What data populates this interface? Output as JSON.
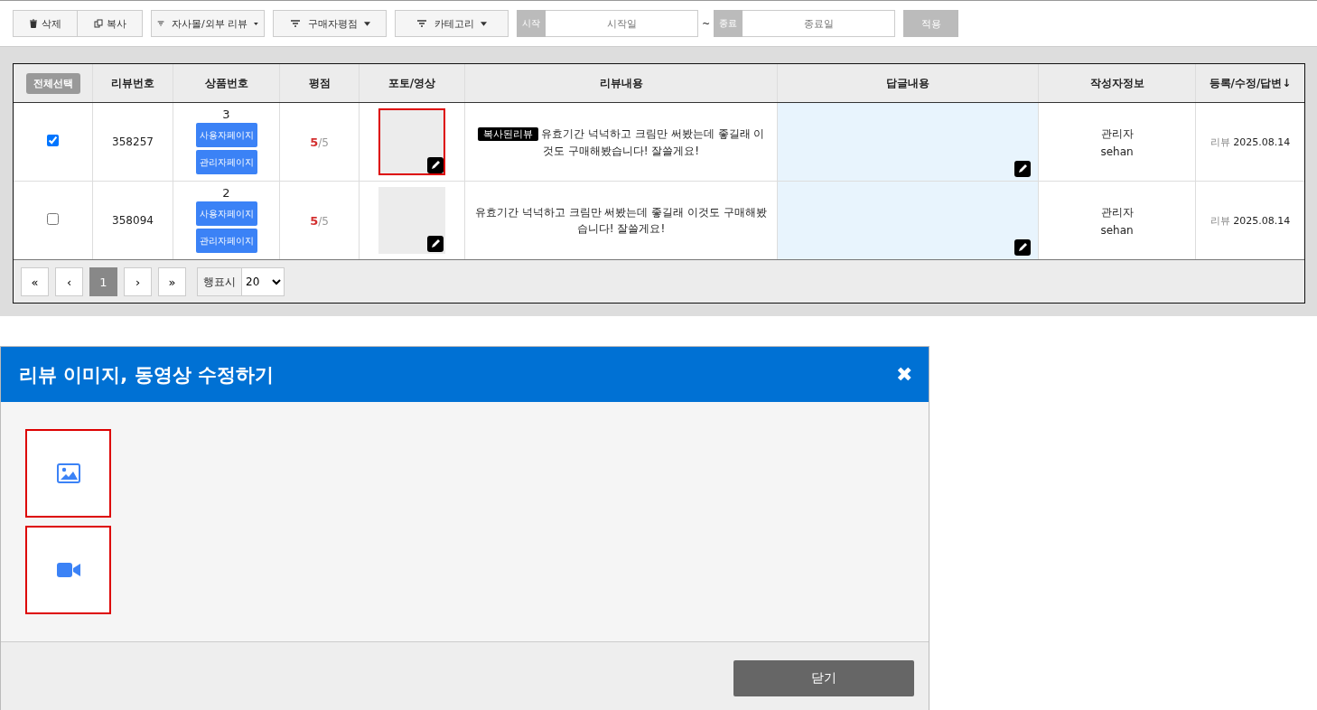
{
  "toolbar": {
    "groups": [
      [
        {
          "kind": "trash",
          "label": "삭제"
        },
        {
          "kind": "copy",
          "label": "복사"
        }
      ],
      [
        {
          "kind": "filter",
          "label": "자사몰/외부 리뷰"
        }
      ],
      [
        {
          "kind": "filter",
          "label": "구매자평점"
        }
      ],
      [
        {
          "kind": "filter",
          "label": "카테고리"
        }
      ]
    ],
    "start": {
      "tag": "시작",
      "placeholder": "시작일"
    },
    "separator": "~",
    "end": {
      "tag": "종료",
      "placeholder": "종료일"
    },
    "apply": "적용"
  },
  "table": {
    "select_all": "전체선택",
    "columns": [
      "리뷰번호",
      "상품번호",
      "평점",
      "포토/영상",
      "리뷰내용",
      "답글내용",
      "작성자정보",
      "등록/수정/답변↓"
    ],
    "rows": [
      {
        "selected": true,
        "review_no": "358257",
        "product_no": "3",
        "user_page": "사용자페이지",
        "admin_page": "관리자페이지",
        "score": "5",
        "max": "/5",
        "photo_highlighted": true,
        "badge": "복사된리뷰",
        "content": "유효기간 넉넉하고 크림만 써봤는데 좋길래 이것도 구매해봤습니다! 잘쓸게요!",
        "author_role": "관리자",
        "author_id": "sehan",
        "date_label": "리뷰",
        "date": "2025.08.14"
      },
      {
        "selected": false,
        "review_no": "358094",
        "product_no": "2",
        "user_page": "사용자페이지",
        "admin_page": "관리자페이지",
        "score": "5",
        "max": "/5",
        "photo_highlighted": false,
        "content": "유효기간 넉넉하고 크림만 써봤는데 좋길래 이것도 구매해봤습니다! 잘쓸게요!",
        "author_role": "관리자",
        "author_id": "sehan",
        "date_label": "리뷰",
        "date": "2025.08.14"
      }
    ]
  },
  "pagination": {
    "first": "«",
    "prev": "‹",
    "pages": [
      {
        "label": "1",
        "selected": true
      }
    ],
    "next": "›",
    "last": "»",
    "rows_label": "행표시",
    "rows_value": "20"
  },
  "modal": {
    "title": "리뷰 이미지, 동영상 수정하기",
    "close_icon": "✖",
    "slots": [
      {
        "kind": "image",
        "highlighted": true
      },
      {
        "kind": "video",
        "highlighted": true
      }
    ],
    "close_button": "닫기"
  }
}
